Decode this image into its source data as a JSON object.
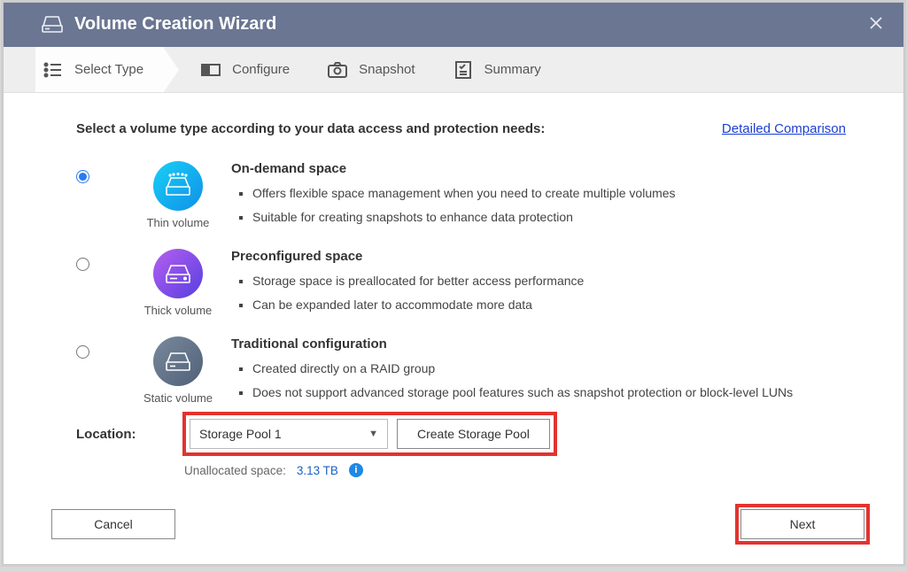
{
  "titlebar": {
    "title": "Volume Creation Wizard"
  },
  "steps": [
    {
      "label": "Select Type"
    },
    {
      "label": "Configure"
    },
    {
      "label": "Snapshot"
    },
    {
      "label": "Summary"
    }
  ],
  "prompt": "Select a volume type according to your data access and protection needs:",
  "detailed_link": "Detailed Comparison",
  "options": [
    {
      "title": "On-demand space",
      "icon_label": "Thin volume",
      "bullets": [
        "Offers flexible space management when you need to create multiple volumes",
        "Suitable for creating snapshots to enhance data protection"
      ]
    },
    {
      "title": "Preconfigured space",
      "icon_label": "Thick volume",
      "bullets": [
        "Storage space is preallocated for better access performance",
        "Can be expanded later to accommodate more data"
      ]
    },
    {
      "title": "Traditional configuration",
      "icon_label": "Static volume",
      "bullets": [
        "Created directly on a RAID group",
        "Does not support advanced storage pool features such as snapshot protection or block-level LUNs"
      ]
    }
  ],
  "location": {
    "label": "Location:",
    "selected": "Storage Pool 1",
    "create_label": "Create Storage Pool",
    "unallocated_label": "Unallocated space:",
    "unallocated_value": "3.13 TB"
  },
  "footer": {
    "cancel": "Cancel",
    "next": "Next"
  }
}
